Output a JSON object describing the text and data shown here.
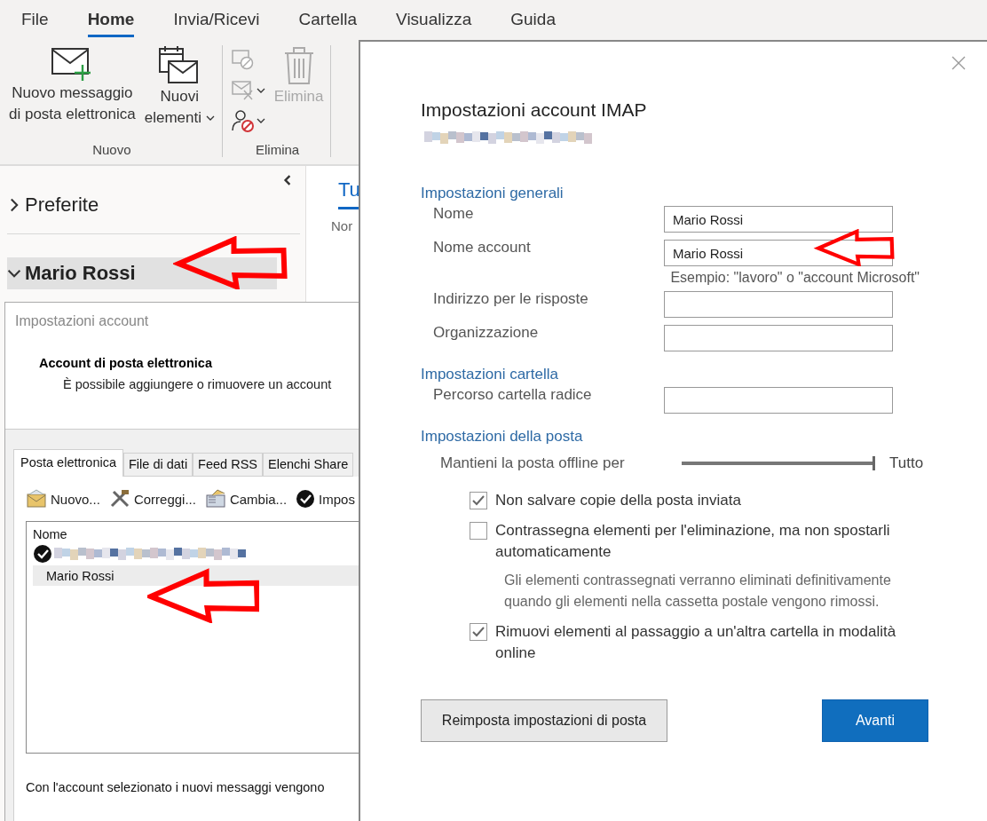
{
  "ribbon": {
    "tabs": [
      {
        "label": "File",
        "selected": false
      },
      {
        "label": "Home",
        "selected": true
      },
      {
        "label": "Invia/Ricevi",
        "selected": false
      },
      {
        "label": "Cartella",
        "selected": false
      },
      {
        "label": "Visualizza",
        "selected": false
      },
      {
        "label": "Guida",
        "selected": false
      }
    ],
    "groups": [
      {
        "label": "Nuovo",
        "buttons": [
          {
            "kind": "new-mail",
            "lines": [
              "Nuovo messaggio",
              "di posta elettronica"
            ],
            "dropdown": false,
            "disabled": false
          },
          {
            "kind": "new-items",
            "lines": [
              "Nuovi",
              "elementi"
            ],
            "dropdown": true,
            "disabled": false
          }
        ]
      },
      {
        "label": "Elimina",
        "small_buttons": [
          {
            "kind": "ignore",
            "dropdown": false
          },
          {
            "kind": "cleanup",
            "dropdown": true
          },
          {
            "kind": "junk",
            "dropdown": true
          }
        ],
        "buttons": [
          {
            "kind": "delete",
            "lines": [
              "Elimina"
            ],
            "dropdown": false,
            "disabled": true
          }
        ]
      }
    ]
  },
  "navigation": {
    "folders": [
      {
        "label": "Preferite",
        "expanded": false,
        "selected": false
      },
      {
        "label": "Mario Rossi",
        "expanded": true,
        "selected": true
      }
    ]
  },
  "message_list": {
    "tabs": [
      {
        "label": "Tu",
        "selected": true
      }
    ],
    "column_1": "Nor"
  },
  "account_settings_dialog": {
    "title": "Impostazioni account",
    "heading": "Account di posta elettronica",
    "description": "È possibile aggiungere o rimuovere un account",
    "tabs": [
      {
        "label": "Posta elettronica",
        "selected": true
      },
      {
        "label": "File di dati",
        "selected": false
      },
      {
        "label": "Feed RSS",
        "selected": false
      },
      {
        "label": "Elenchi Share",
        "selected": false
      }
    ],
    "toolbar": [
      {
        "kind": "new",
        "label": "Nuovo..."
      },
      {
        "kind": "repair",
        "label": "Correggi..."
      },
      {
        "kind": "change",
        "label": "Cambia..."
      },
      {
        "kind": "default",
        "label": "Impos"
      }
    ],
    "list": {
      "header": "Nome",
      "rows": [
        {
          "kind": "redacted",
          "default": true,
          "selected": false
        },
        {
          "kind": "name",
          "label": "Mario Rossi",
          "default": false,
          "selected": true
        }
      ]
    },
    "footer": "Con l'account selezionato i nuovi messaggi vengono"
  },
  "imap_dialog": {
    "title": "Impostazioni account IMAP",
    "sections": [
      {
        "title": "Impostazioni generali",
        "fields": [
          {
            "label": "Nome",
            "value": "Mario Rossi"
          },
          {
            "label": "Nome account",
            "value": "Mario Rossi",
            "hint": "Esempio: \"lavoro\" o \"account Microsoft\""
          },
          {
            "label": "Indirizzo per le risposte"
          },
          {
            "label": "Organizzazione"
          }
        ]
      },
      {
        "title": "Impostazioni cartella",
        "fields": [
          {
            "label": "Percorso cartella radice"
          }
        ]
      }
    ],
    "mail_settings": {
      "title": "Impostazioni della posta",
      "slider": {
        "label": "Mantieni la posta offline per",
        "level": 1,
        "reading": "Tutto"
      },
      "options": [
        {
          "label": "Non salvare copie della posta inviata",
          "checked": true
        },
        {
          "label": "Contrassegna elementi per l'eliminazione, ma non spostarli automaticamente",
          "checked": false,
          "note": "Gli elementi contrassegnati verranno eliminati definitivamente quando gli elementi nella cassetta postale vengono rimossi."
        },
        {
          "label": "Rimuovi elementi al passaggio a un'altra cartella in modalità online",
          "checked": true
        }
      ]
    },
    "buttons": [
      {
        "kind": "secondary",
        "label": "Reimposta impostazioni di posta"
      },
      {
        "kind": "primary",
        "label": "Avanti"
      }
    ]
  }
}
